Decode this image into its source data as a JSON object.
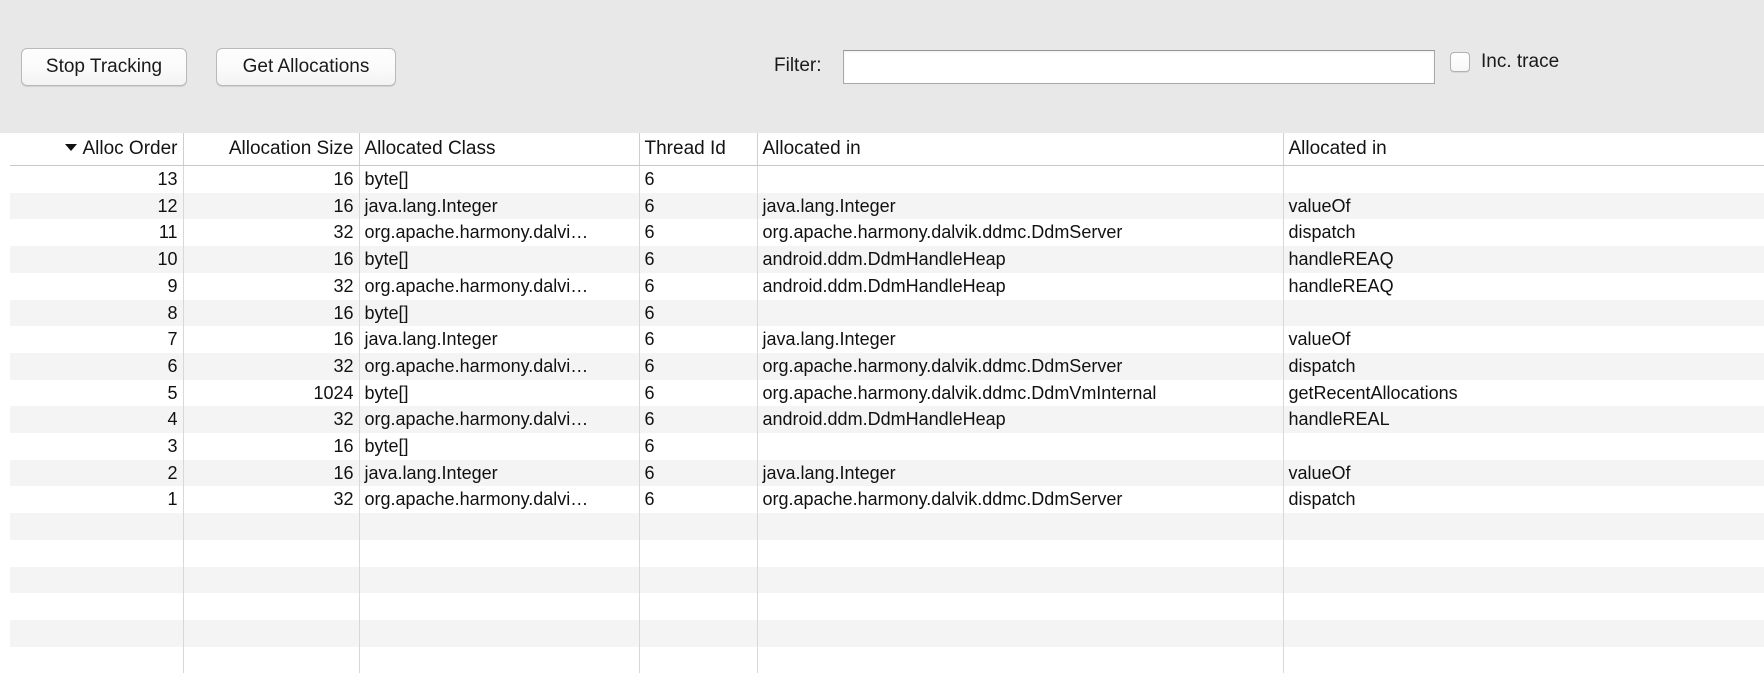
{
  "toolbar": {
    "stop_tracking_label": "Stop Tracking",
    "get_allocations_label": "Get Allocations",
    "filter_label": "Filter:",
    "filter_value": "",
    "filter_placeholder": "",
    "inc_trace_label": "Inc. trace",
    "inc_trace_checked": false
  },
  "table": {
    "sort_column_index": 0,
    "sort_direction": "desc",
    "columns": [
      {
        "label": "Alloc Order",
        "align": "num"
      },
      {
        "label": "Allocation Size",
        "align": "num"
      },
      {
        "label": "Allocated Class",
        "align": "txt"
      },
      {
        "label": "Thread Id",
        "align": "txt"
      },
      {
        "label": "Allocated in",
        "align": "txt"
      },
      {
        "label": "Allocated in",
        "align": "txt"
      }
    ],
    "rows": [
      {
        "alloc_order": "13",
        "allocation_size": "16",
        "allocated_class": "byte[]",
        "thread_id": "6",
        "allocated_in_class": "",
        "allocated_in_method": ""
      },
      {
        "alloc_order": "12",
        "allocation_size": "16",
        "allocated_class": "java.lang.Integer",
        "thread_id": "6",
        "allocated_in_class": "java.lang.Integer",
        "allocated_in_method": "valueOf"
      },
      {
        "alloc_order": "11",
        "allocation_size": "32",
        "allocated_class": "org.apache.harmony.dalvi…",
        "thread_id": "6",
        "allocated_in_class": "org.apache.harmony.dalvik.ddmc.DdmServer",
        "allocated_in_method": "dispatch"
      },
      {
        "alloc_order": "10",
        "allocation_size": "16",
        "allocated_class": "byte[]",
        "thread_id": "6",
        "allocated_in_class": "android.ddm.DdmHandleHeap",
        "allocated_in_method": "handleREAQ"
      },
      {
        "alloc_order": "9",
        "allocation_size": "32",
        "allocated_class": "org.apache.harmony.dalvi…",
        "thread_id": "6",
        "allocated_in_class": "android.ddm.DdmHandleHeap",
        "allocated_in_method": "handleREAQ"
      },
      {
        "alloc_order": "8",
        "allocation_size": "16",
        "allocated_class": "byte[]",
        "thread_id": "6",
        "allocated_in_class": "",
        "allocated_in_method": ""
      },
      {
        "alloc_order": "7",
        "allocation_size": "16",
        "allocated_class": "java.lang.Integer",
        "thread_id": "6",
        "allocated_in_class": "java.lang.Integer",
        "allocated_in_method": "valueOf"
      },
      {
        "alloc_order": "6",
        "allocation_size": "32",
        "allocated_class": "org.apache.harmony.dalvi…",
        "thread_id": "6",
        "allocated_in_class": "org.apache.harmony.dalvik.ddmc.DdmServer",
        "allocated_in_method": "dispatch"
      },
      {
        "alloc_order": "5",
        "allocation_size": "1024",
        "allocated_class": "byte[]",
        "thread_id": "6",
        "allocated_in_class": "org.apache.harmony.dalvik.ddmc.DdmVmInternal",
        "allocated_in_method": "getRecentAllocations"
      },
      {
        "alloc_order": "4",
        "allocation_size": "32",
        "allocated_class": "org.apache.harmony.dalvi…",
        "thread_id": "6",
        "allocated_in_class": "android.ddm.DdmHandleHeap",
        "allocated_in_method": "handleREAL"
      },
      {
        "alloc_order": "3",
        "allocation_size": "16",
        "allocated_class": "byte[]",
        "thread_id": "6",
        "allocated_in_class": "",
        "allocated_in_method": ""
      },
      {
        "alloc_order": "2",
        "allocation_size": "16",
        "allocated_class": "java.lang.Integer",
        "thread_id": "6",
        "allocated_in_class": "java.lang.Integer",
        "allocated_in_method": "valueOf"
      },
      {
        "alloc_order": "1",
        "allocation_size": "32",
        "allocated_class": "org.apache.harmony.dalvi…",
        "thread_id": "6",
        "allocated_in_class": "org.apache.harmony.dalvik.ddmc.DdmServer",
        "allocated_in_method": "dispatch"
      },
      {
        "alloc_order": "",
        "allocation_size": "",
        "allocated_class": "",
        "thread_id": "",
        "allocated_in_class": "",
        "allocated_in_method": ""
      },
      {
        "alloc_order": "",
        "allocation_size": "",
        "allocated_class": "",
        "thread_id": "",
        "allocated_in_class": "",
        "allocated_in_method": ""
      },
      {
        "alloc_order": "",
        "allocation_size": "",
        "allocated_class": "",
        "thread_id": "",
        "allocated_in_class": "",
        "allocated_in_method": ""
      },
      {
        "alloc_order": "",
        "allocation_size": "",
        "allocated_class": "",
        "thread_id": "",
        "allocated_in_class": "",
        "allocated_in_method": ""
      },
      {
        "alloc_order": "",
        "allocation_size": "",
        "allocated_class": "",
        "thread_id": "",
        "allocated_in_class": "",
        "allocated_in_method": ""
      },
      {
        "alloc_order": "",
        "allocation_size": "",
        "allocated_class": "",
        "thread_id": "",
        "allocated_in_class": "",
        "allocated_in_method": ""
      }
    ]
  },
  "colors": {
    "toolbar_bg": "#e8e8e8",
    "row_alt_bg": "#f4f4f4",
    "row_bg": "#ffffff",
    "text": "#111111",
    "grid_line": "#d8d8d8"
  }
}
